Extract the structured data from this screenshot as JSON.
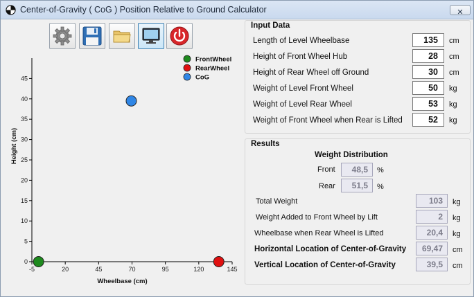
{
  "window": {
    "title": "Center-of-Gravity ( CoG ) Position Relative to Ground Calculator",
    "close_label": "✕"
  },
  "toolbar": {
    "buttons": [
      {
        "name": "settings",
        "icon": "gear-icon"
      },
      {
        "name": "save",
        "icon": "floppy-disk-icon"
      },
      {
        "name": "open",
        "icon": "folder-icon"
      },
      {
        "name": "display",
        "icon": "monitor-icon",
        "active": true
      },
      {
        "name": "exit",
        "icon": "power-icon"
      }
    ]
  },
  "chart_data": {
    "type": "scatter",
    "xlabel": "Wheelbase (cm)",
    "ylabel": "Height (cm)",
    "xlim": [
      -5,
      145
    ],
    "ylim": [
      0,
      50
    ],
    "x_ticks": [
      "-5",
      "20",
      "45",
      "70",
      "95",
      "120",
      "145"
    ],
    "y_ticks": [
      "0",
      "5",
      "10",
      "15",
      "20",
      "25",
      "30",
      "35",
      "40",
      "45"
    ],
    "legend_position": "top-right",
    "series": [
      {
        "name": "FrontWheel",
        "color": "#1e8a1e",
        "points": [
          [
            0,
            0
          ]
        ]
      },
      {
        "name": "RearWheel",
        "color": "#e01010",
        "points": [
          [
            135,
            0
          ]
        ]
      },
      {
        "name": "CoG",
        "color": "#2f86e6",
        "points": [
          [
            69.47,
            39.5
          ]
        ]
      }
    ]
  },
  "input": {
    "title": "Input Data",
    "rows": [
      {
        "label": "Length of Level Wheelbase",
        "value": "135",
        "unit": "cm"
      },
      {
        "label": "Height of Front Wheel Hub",
        "value": "28",
        "unit": "cm"
      },
      {
        "label": "Height of Rear Wheel off Ground",
        "value": "30",
        "unit": "cm"
      },
      {
        "label": "Weight of Level Front Wheel",
        "value": "50",
        "unit": "kg"
      },
      {
        "label": "Weight of Level Rear Wheel",
        "value": "53",
        "unit": "kg"
      },
      {
        "label": "Weight of Front Wheel when Rear is Lifted",
        "value": "52",
        "unit": "kg"
      }
    ]
  },
  "results": {
    "title": "Results",
    "distribution": {
      "heading": "Weight Distribution",
      "front_label": "Front",
      "front_value": "48,5",
      "rear_label": "Rear",
      "rear_value": "51,5",
      "unit": "%"
    },
    "rows": [
      {
        "label": "Total Weight",
        "value": "103",
        "unit": "kg",
        "bold": false
      },
      {
        "label": "Weight Added to Front Wheel by Lift",
        "value": "2",
        "unit": "kg",
        "bold": false
      },
      {
        "label": "Wheelbase when Rear Wheel is Lifted",
        "value": "20,4",
        "unit": "kg",
        "bold": false
      },
      {
        "label": "Horizontal Location of Center-of-Gravity",
        "value": "69,47",
        "unit": "cm",
        "bold": true
      },
      {
        "label": "Vertical Location of Center-of-Gravity",
        "value": "39,5",
        "unit": "cm",
        "bold": true
      }
    ]
  }
}
